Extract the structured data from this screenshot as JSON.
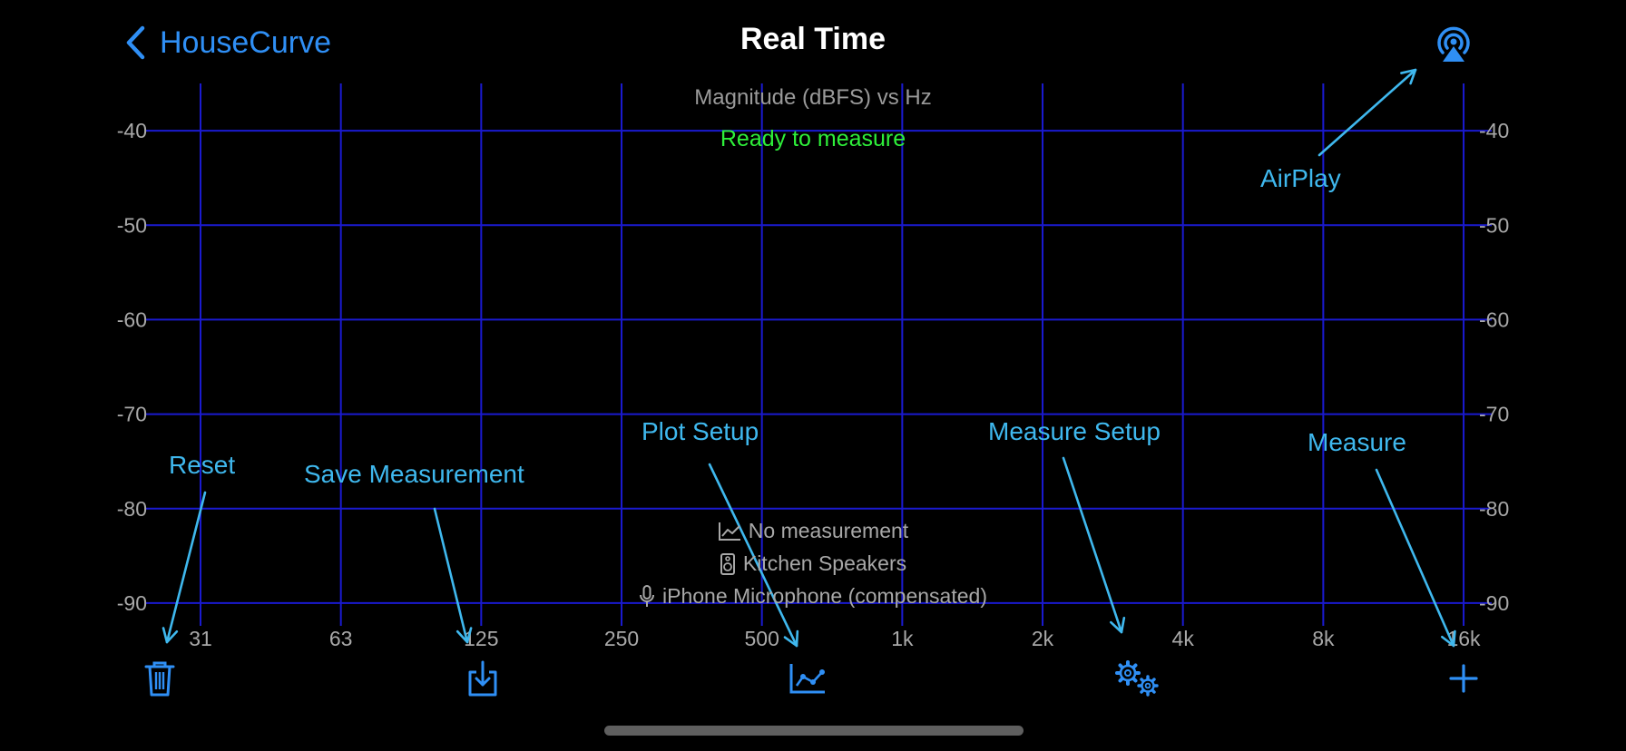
{
  "nav": {
    "back_label": "HouseCurve",
    "title": "Real Time"
  },
  "status": "Ready to measure",
  "info": {
    "measurement": "No measurement",
    "speaker": "Kitchen Speakers",
    "microphone": "iPhone Microphone (compensated)"
  },
  "chart_data": {
    "type": "line",
    "title": "Magnitude (dBFS) vs Hz",
    "xlabel": "",
    "ylabel": "",
    "x_scale": "log",
    "x_ticks": [
      "31",
      "63",
      "125",
      "250",
      "500",
      "1k",
      "2k",
      "4k",
      "8k",
      "16k"
    ],
    "y_ticks": [
      "-40",
      "-50",
      "-60",
      "-70",
      "-80",
      "-90"
    ],
    "y_ticks_right": [
      "-40",
      "-50",
      "-60",
      "-70",
      "-80",
      "-90"
    ],
    "ylim": [
      -95,
      -35
    ],
    "series": [],
    "grid": true
  },
  "toolbar": [
    "trash-icon",
    "save-icon",
    "plot-setup-icon",
    "measure-setup-icon",
    "plus-icon"
  ],
  "callouts": {
    "airplay": "AirPlay",
    "reset": "Reset",
    "save": "Save Measurement",
    "plot_setup": "Plot Setup",
    "measure_setup": "Measure Setup",
    "measure": "Measure"
  },
  "colors": {
    "accent": "#2f8ff5",
    "grid": "#1a1ad0",
    "status": "#2ef03a",
    "callout": "#3fb8ee"
  }
}
